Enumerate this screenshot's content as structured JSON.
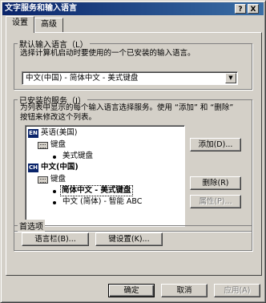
{
  "window": {
    "title": "文字服务和输入语言",
    "help_btn": "?",
    "close_btn": "X"
  },
  "tabs": [
    {
      "label": "设置"
    },
    {
      "label": "高级"
    }
  ],
  "default_lang": {
    "group_label": "默认输入语言（L）",
    "description": "选择计算机启动时要使用的一个已安装的输入语言。",
    "selected": "中文(中国) - 简体中文 - 美式键盘",
    "dropdown_arrow": "▼"
  },
  "installed": {
    "group_label": "已安装的服务（I）",
    "description_line1": "为列表中显示的每个输入语言选择服务。使用 “添加” 和 “删除”",
    "description_line2": "按钮来修改这个列表。",
    "tree": {
      "lang1": {
        "icon": "EN",
        "label": "英语(美国)"
      },
      "lang1_group": "键盘",
      "lang1_item1": "美式键盘",
      "lang2": {
        "icon": "CH",
        "label": "中文(中国)"
      },
      "lang2_group": "键盘",
      "lang2_item1": "简体中文 - 美式键盘",
      "lang2_item2": "中文 (简体) - 智能 ABC"
    },
    "add_button": "添加(D)...",
    "remove_button": "删除(R)",
    "properties_button": "属性(P)..."
  },
  "prefs": {
    "group_label": "首选项",
    "langbar_button": "语言栏(B)...",
    "keysettings_button": "键设置(K)..."
  },
  "footer": {
    "ok": "确定",
    "cancel": "取消",
    "apply": "应用(A)"
  }
}
